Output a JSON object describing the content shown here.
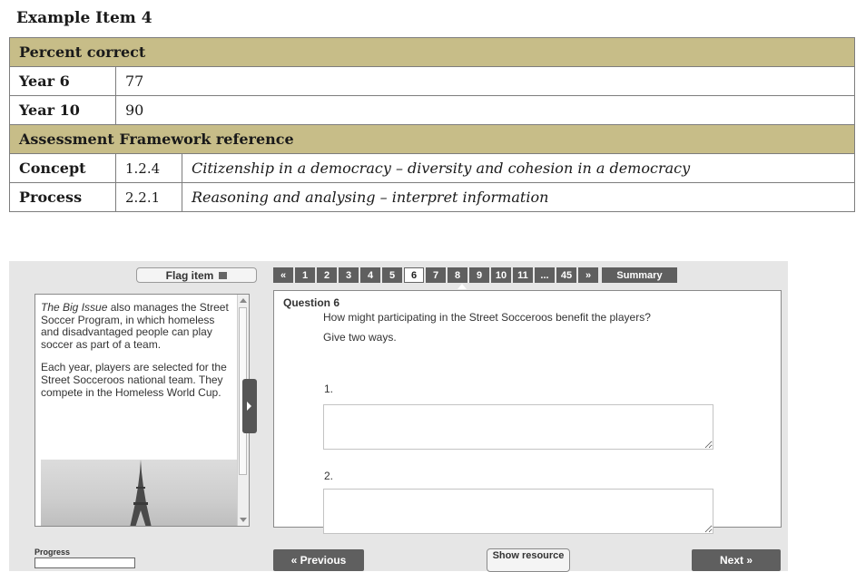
{
  "document": {
    "title": "Example Item 4",
    "percent_correct_header": "Percent correct",
    "rows": [
      {
        "label": "Year 6",
        "value": "77"
      },
      {
        "label": "Year 10",
        "value": "90"
      }
    ],
    "framework_header": "Assessment Framework reference",
    "framework": [
      {
        "label": "Concept",
        "code": "1.2.4",
        "description": "Citizenship in a democracy – diversity and cohesion in a democracy"
      },
      {
        "label": "Process",
        "code": "2.2.1",
        "description": "Reasoning and analysing – interpret information"
      }
    ],
    "header_color": "#c7bd88"
  },
  "app": {
    "flag_label": "Flag item",
    "resource": {
      "para1_italic": "The Big Issue",
      "para1_rest": " also manages the Street Soccer Program, in which homeless and disadvantaged people can play soccer as part of a team.",
      "para2": "Each year, players are selected for the Street Socceroos national team. They compete in the Homeless World Cup.",
      "image_icon": "eiffel-tower-image"
    },
    "nav": {
      "first": "«",
      "pages": [
        "1",
        "2",
        "3",
        "4",
        "5",
        "6",
        "7",
        "8",
        "9",
        "10",
        "11",
        "...",
        "45"
      ],
      "active_page": "6",
      "last": "»",
      "summary": "Summary"
    },
    "question": {
      "title": "Question 6",
      "text": "How might participating in the Street Socceroos benefit the players?",
      "sub": "Give two ways.",
      "answer1_label": "1.",
      "answer2_label": "2.",
      "answer1_value": "",
      "answer2_value": ""
    },
    "progress_label": "Progress",
    "progress_fraction": 0,
    "previous_label": "« Previous",
    "show_resource_label": "Show resource",
    "next_label": "Next »",
    "button_color": "#5f5f5f"
  }
}
